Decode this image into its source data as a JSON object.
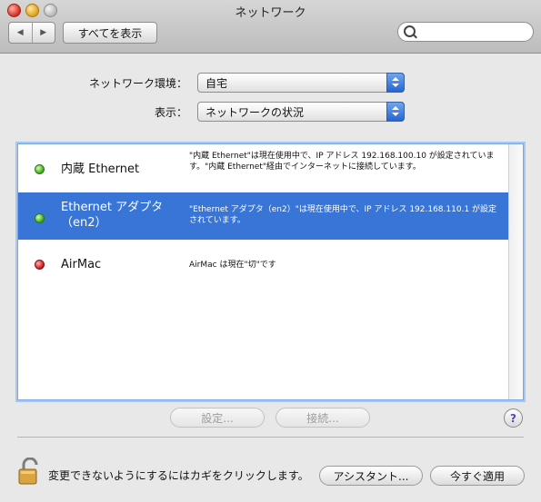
{
  "window": {
    "title": "ネットワーク",
    "show_all": "すべてを表示",
    "search_placeholder": ""
  },
  "form": {
    "location_label": "ネットワーク環境：",
    "location_value": "自宅",
    "show_label": "表示：",
    "show_value": "ネットワークの状況"
  },
  "services": [
    {
      "name": "内蔵 Ethernet",
      "status_color": "#37a81b",
      "description": "\"内蔵 Ethernet\"は現在使用中で、IP アドレス 192.168.100.10 が設定されています。\"内蔵 Ethernet\"経由でインターネットに接続しています。",
      "selected": false
    },
    {
      "name": "Ethernet アダプタ（en2）",
      "status_color": "#37a81b",
      "description": "\"Ethernet アダプタ（en2）\"は現在使用中で、IP アドレス 192.168.110.1 が設定されています。",
      "selected": true
    },
    {
      "name": "AirMac",
      "status_color": "#c8141a",
      "description": "AirMac は現在\"切\"です",
      "selected": false
    }
  ],
  "buttons": {
    "configure": "設定...",
    "connect": "接続...",
    "help": "?",
    "assistant": "アシスタント...",
    "apply_now": "今すぐ適用"
  },
  "footer": {
    "lock_text": "変更できないようにするにはカギをクリックします。"
  },
  "colors": {
    "selection": "#3875d7",
    "accent": "#2764d3"
  }
}
